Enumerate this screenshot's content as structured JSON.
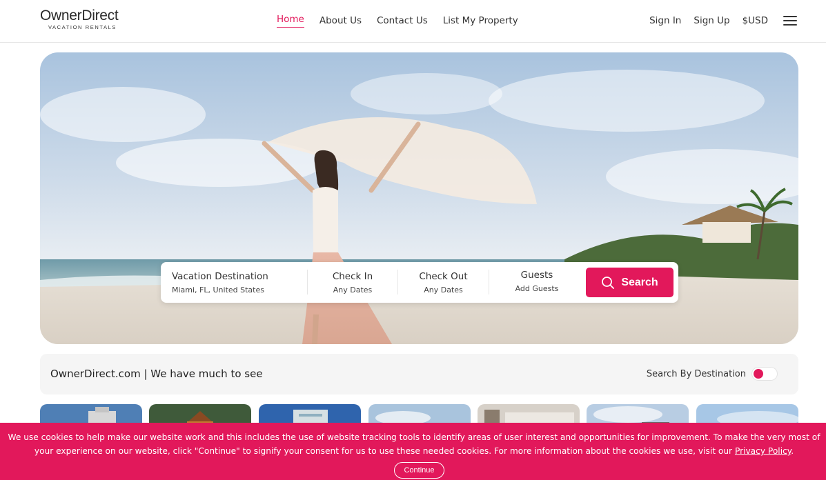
{
  "header": {
    "logo_main": "OwnerDirect",
    "logo_sub": "VACATION RENTALS",
    "nav": [
      {
        "label": "Home",
        "active": true
      },
      {
        "label": "About Us"
      },
      {
        "label": "Contact Us"
      },
      {
        "label": "List My Property"
      }
    ],
    "right": {
      "sign_in": "Sign In",
      "sign_up": "Sign Up",
      "currency": "$USD",
      "menu_icon": "hamburger-menu-icon"
    }
  },
  "search": {
    "destination_label": "Vacation Destination",
    "destination_value": "Miami, FL, United States",
    "checkin_label": "Check In",
    "checkin_value": "Any Dates",
    "checkout_label": "Check Out",
    "checkout_value": "Any Dates",
    "guests_label": "Guests",
    "guests_value": "Add Guests",
    "button_label": "Search",
    "button_icon": "search-icon"
  },
  "info": {
    "title": "OwnerDirect.com | We have much to see",
    "toggle_label": "Search By Destination",
    "toggle_on": false
  },
  "cookie": {
    "text_before_link": "We use cookies to help make our website work and this includes the use of website tracking tools to identify areas of user interest and opportunities for improvement. To make the very most of your experience on our website, click \"Continue\" to signify your consent for us to use these needed cookies. For more information about the cookies we use, visit our",
    "link": "Privacy Policy",
    "text_after_link": ".",
    "button": "Continue"
  },
  "colors": {
    "accent": "#e2185b",
    "text": "#222222",
    "strip_bg": "#f5f5f5"
  }
}
